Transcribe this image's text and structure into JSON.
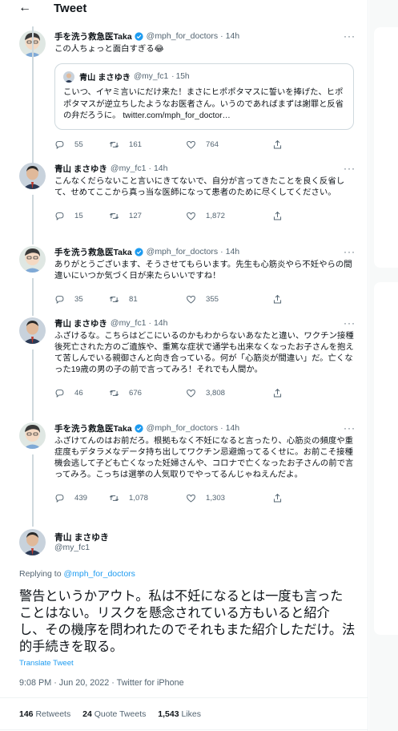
{
  "header": {
    "title": "Tweet"
  },
  "tweets": [
    {
      "name": "手を洗う救急医Taka",
      "handle": "@mph_for_doctors",
      "time": "14h",
      "verified": true,
      "text": "この人ちょっと面白すぎる😂",
      "quote": {
        "name": "青山 まさゆき",
        "handle": "@my_fc1",
        "time": "15h",
        "text": "こいつ、イヤミ言いにだけ来た！まさにヒポポタマスに誓いを捧げた、ヒポポタマスが逆立ちしたようなお医者さん。いうのであればまずは謝罪と反省の弁だろうに。 twitter.com/mph_for_doctor…"
      },
      "replies": "55",
      "retweets": "161",
      "likes": "764"
    },
    {
      "name": "青山 まさゆき",
      "handle": "@my_fc1",
      "time": "14h",
      "verified": false,
      "text": "こんなくだらないこと言いにきてないで、自分が言ってきたことを良く反省して、せめてここから真っ当な医師になって患者のために尽くしてください。",
      "replies": "15",
      "retweets": "127",
      "likes": "1,872"
    },
    {
      "name": "手を洗う救急医Taka",
      "handle": "@mph_for_doctors",
      "time": "14h",
      "verified": true,
      "text": "ありがとうございます、そうさせてもらいます。先生も心筋炎やら不妊やらの間違いにいつか気づく日が来たらいいですね！",
      "replies": "35",
      "retweets": "81",
      "likes": "355"
    },
    {
      "name": "青山 まさゆき",
      "handle": "@my_fc1",
      "time": "14h",
      "verified": false,
      "text": "ふざけるな。こちらはどこにいるのかもわからないあなたと違い、ワクチン接種後死亡された方のご遺族や、重篤な症状で通学も出来なくなったお子さんを抱えて苦しんでいる親御さんと向き合っている。何が「心筋炎が間違い」だ。亡くなった19歳の男の子の前で言ってみろ！それでも人間か。",
      "replies": "46",
      "retweets": "676",
      "likes": "3,808"
    },
    {
      "name": "手を洗う救急医Taka",
      "handle": "@mph_for_doctors",
      "time": "14h",
      "verified": true,
      "text": "ふざけてんのはお前だろ。根拠もなく不妊になると言ったり、心筋炎の頻度や重症度もデタラメなデータ持ち出してワクチン忌避煽ってるくせに。お前こそ接種機会逃して子ども亡くなった妊婦さんや、コロナで亡くなったお子さんの前で言ってみろ。こっちは選挙の人気取りでやってるんじゃねえんだよ。",
      "replies": "439",
      "retweets": "1,078",
      "likes": "1,303"
    }
  ],
  "main": {
    "name": "青山 まさゆき",
    "handle": "@my_fc1",
    "replying_prefix": "Replying to",
    "replying_to": "@mph_for_doctors",
    "text": "警告というかアウト。私は不妊になるとは一度も言ったことはない。リスクを懸念されている方もいると紹介し、その機序を問われたのでそれもまた紹介しただけ。法的手続きを取る。",
    "translate": "Translate Tweet",
    "timestamp": "9:08 PM · Jun 20, 2022 · Twitter for iPhone",
    "retweets": "146",
    "retweets_label": "Retweets",
    "quote_tweets": "24",
    "quote_tweets_label": "Quote Tweets",
    "likes": "1,543",
    "likes_label": "Likes"
  },
  "colors": {
    "accent": "#1d9bf0",
    "text": "#0f1419",
    "muted": "#536471",
    "border": "#cfd9de"
  }
}
